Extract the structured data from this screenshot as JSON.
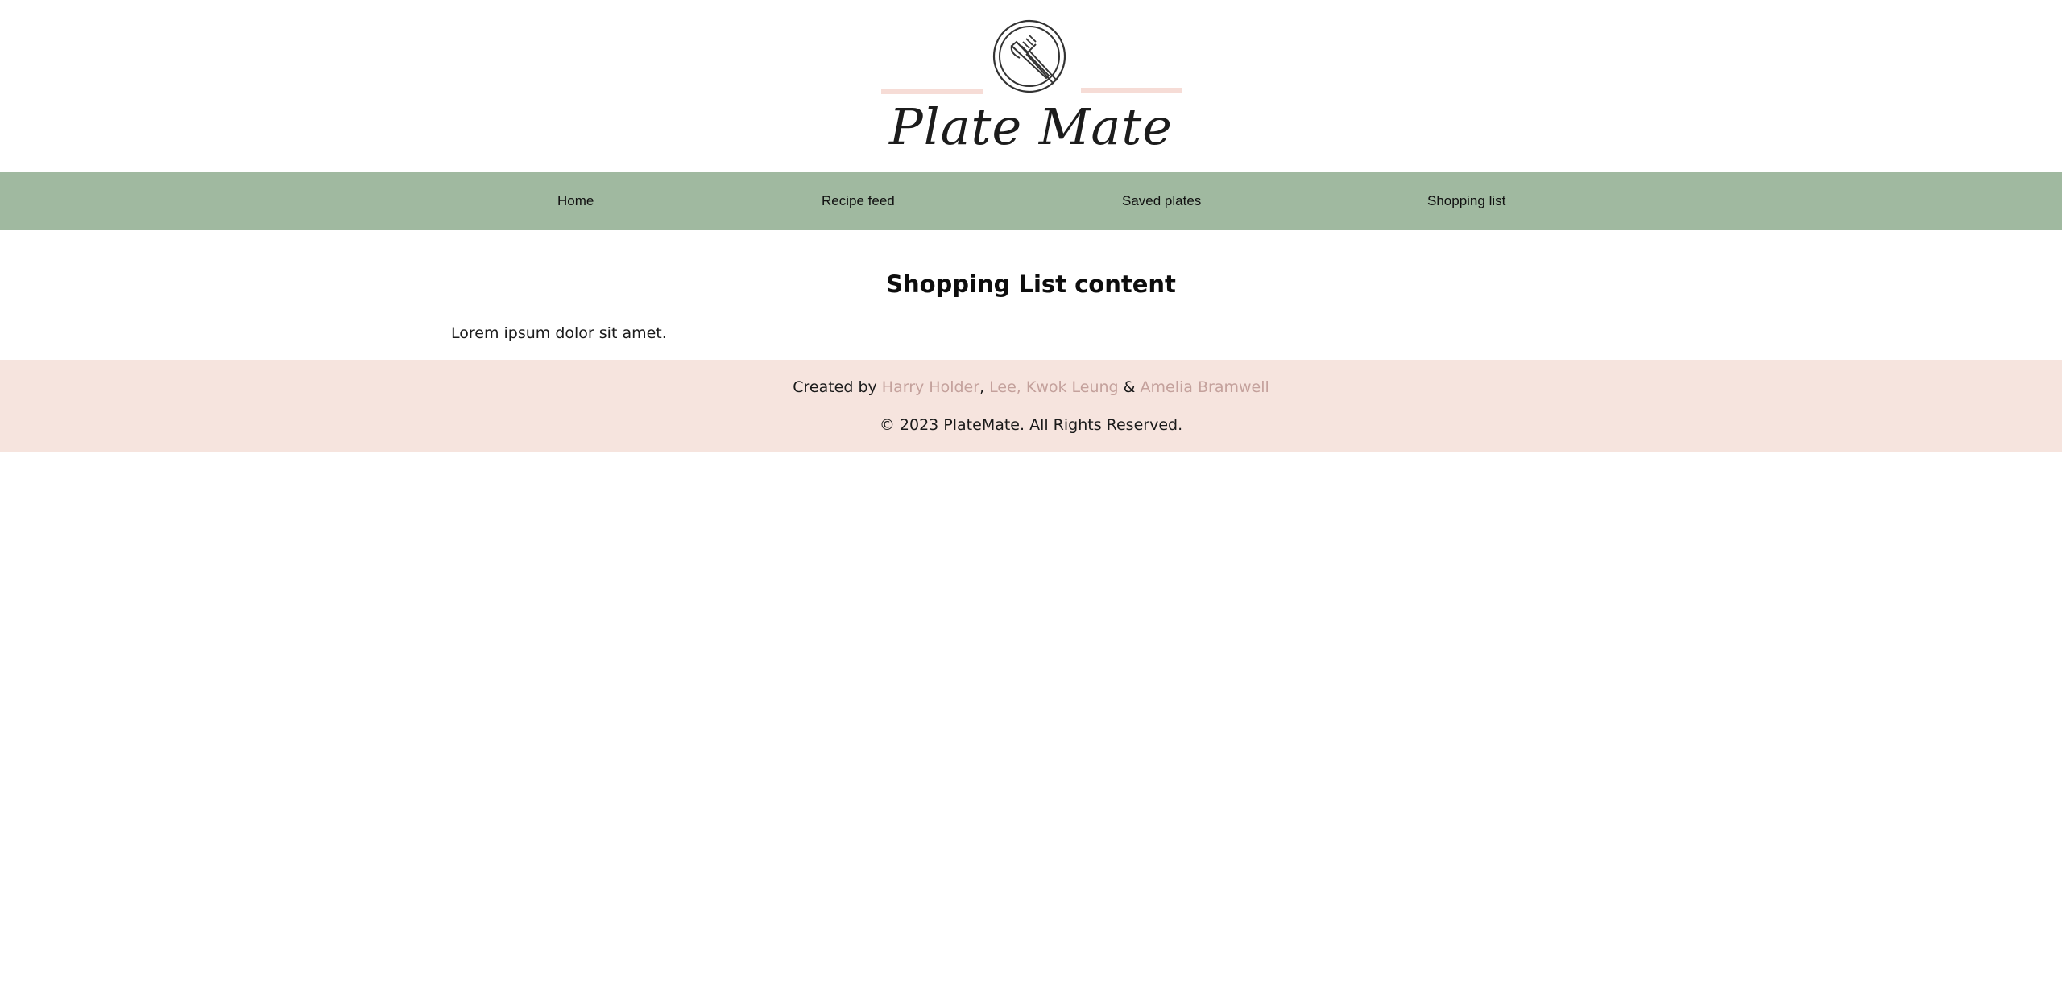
{
  "header": {
    "logo_icon": "plate-fork-knife-icon",
    "brand_name": "Plate Mate"
  },
  "nav": {
    "items": [
      {
        "label": "Home"
      },
      {
        "label": "Recipe feed"
      },
      {
        "label": "Saved plates"
      },
      {
        "label": "Shopping list"
      }
    ]
  },
  "main": {
    "title": "Shopping List content",
    "text": "Lorem ipsum dolor sit amet."
  },
  "footer": {
    "created_by_prefix": "Created by ",
    "authors": [
      {
        "name": "Harry Holder",
        "separator_after": ", "
      },
      {
        "name": "Lee, Kwok Leung",
        "separator_after": " & "
      },
      {
        "name": "Amelia Bramwell",
        "separator_after": ""
      }
    ],
    "copyright": "© 2023 PlateMate. All Rights Reserved."
  },
  "colors": {
    "nav_background": "#a0b9a0",
    "footer_background": "#f6e4de",
    "logo_accent_pink": "#f6dcd6",
    "link_color": "#c4a19c"
  }
}
